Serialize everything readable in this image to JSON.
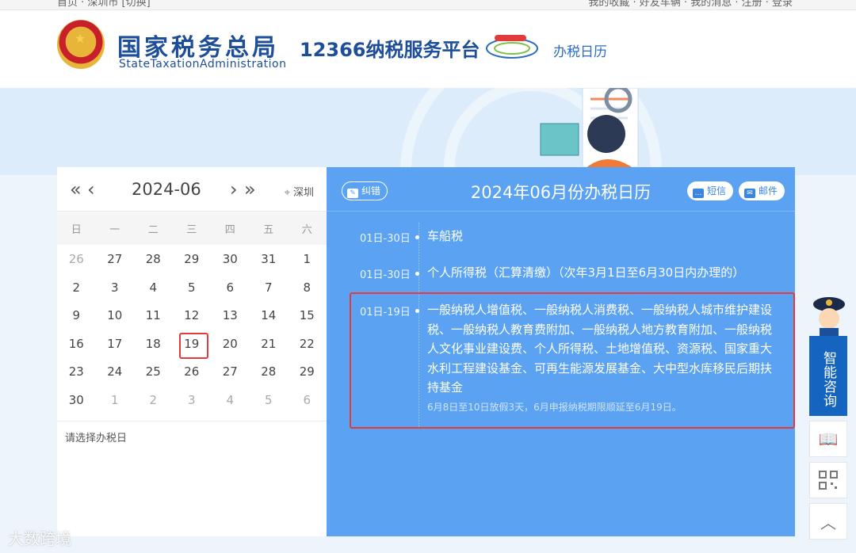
{
  "topbar": {
    "home": "首页",
    "location": "深圳市 [切换]",
    "links": "我的收藏 · 好友车辆 · 我的消息 · 注册 · 登录"
  },
  "header": {
    "org_cn": "国家税务总局",
    "org_en": "StateTaxationAdministration",
    "platform": "12366纳税服务平台",
    "page_name": "办税日历"
  },
  "calendar": {
    "prev_year": "«",
    "prev_month": "‹",
    "month": "2024-06",
    "next_month": "›",
    "next_year": "»",
    "city": "深圳",
    "weekdays": [
      "日",
      "一",
      "二",
      "三",
      "四",
      "五",
      "六"
    ],
    "days": [
      {
        "d": "26",
        "muted": true
      },
      {
        "d": "27",
        "muted": false
      },
      {
        "d": "28",
        "muted": false
      },
      {
        "d": "29",
        "muted": false
      },
      {
        "d": "30",
        "muted": false
      },
      {
        "d": "31",
        "muted": false
      },
      {
        "d": "1",
        "muted": false
      },
      {
        "d": "2",
        "muted": false
      },
      {
        "d": "3",
        "muted": false
      },
      {
        "d": "4",
        "muted": false
      },
      {
        "d": "5",
        "muted": false
      },
      {
        "d": "6",
        "muted": false
      },
      {
        "d": "7",
        "muted": false
      },
      {
        "d": "8",
        "muted": false
      },
      {
        "d": "9",
        "muted": false
      },
      {
        "d": "10",
        "muted": false
      },
      {
        "d": "11",
        "muted": false
      },
      {
        "d": "12",
        "muted": false
      },
      {
        "d": "13",
        "muted": false
      },
      {
        "d": "14",
        "muted": false
      },
      {
        "d": "15",
        "muted": false
      },
      {
        "d": "16",
        "muted": false
      },
      {
        "d": "17",
        "muted": false
      },
      {
        "d": "18",
        "muted": false
      },
      {
        "d": "19",
        "muted": false
      },
      {
        "d": "20",
        "muted": false
      },
      {
        "d": "21",
        "muted": false
      },
      {
        "d": "22",
        "muted": false
      },
      {
        "d": "23",
        "muted": false
      },
      {
        "d": "24",
        "muted": false
      },
      {
        "d": "25",
        "muted": false
      },
      {
        "d": "26",
        "muted": false
      },
      {
        "d": "27",
        "muted": false
      },
      {
        "d": "28",
        "muted": false
      },
      {
        "d": "29",
        "muted": false
      },
      {
        "d": "30",
        "muted": false
      },
      {
        "d": "1",
        "muted": true
      },
      {
        "d": "2",
        "muted": true
      },
      {
        "d": "3",
        "muted": true
      },
      {
        "d": "4",
        "muted": true
      },
      {
        "d": "5",
        "muted": true
      },
      {
        "d": "6",
        "muted": true
      }
    ],
    "selected_day": "19",
    "hint": "请选择办税日"
  },
  "schedule": {
    "correct_button": "纠错",
    "title": "2024年06月份办税日历",
    "sms_button": "短信",
    "mail_button": "邮件",
    "items": [
      {
        "date": "01日-30日",
        "text": "车船税",
        "note": ""
      },
      {
        "date": "01日-30日",
        "text": "个人所得税（汇算清缴）（次年3月1日至6月30日内办理的）",
        "note": ""
      },
      {
        "date": "01日-19日",
        "text": "一般纳税人增值税、一般纳税人消费税、一般纳税人城市维护建设税、一般纳税人教育费附加、一般纳税人地方教育附加、一般纳税人文化事业建设费、个人所得税、土地增值税、资源税、国家重大水利工程建设基金、可再生能源发展基金、大中型水库移民后期扶持基金",
        "note": "6月8日至10日放假3天，6月申报纳税期限顺延至6月19日。"
      }
    ]
  },
  "sidebar": {
    "consult": "智能咨询"
  },
  "watermark": "大数跨境",
  "colors": {
    "panel_blue": "#5ba3f2",
    "brand_blue": "#1d4e9a",
    "highlight_red": "#e23b3b",
    "consult_blue": "#1565c0"
  }
}
